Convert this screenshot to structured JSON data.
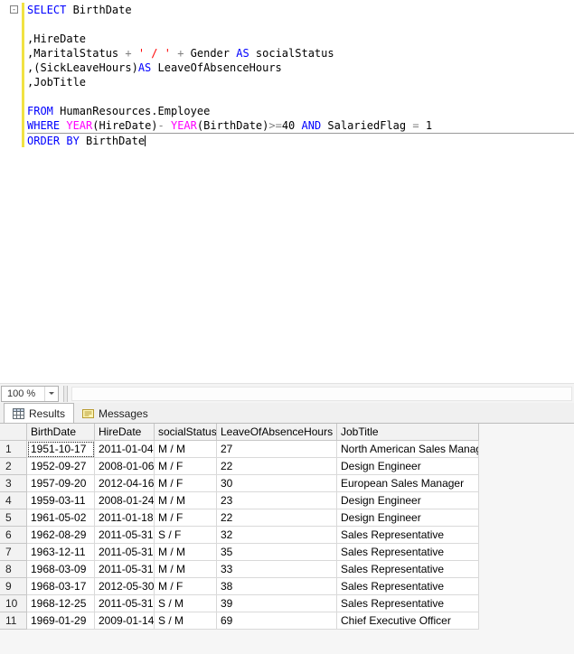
{
  "colors": {
    "keyword": "#0000ff",
    "function": "#ff00ff",
    "string": "#ff0000",
    "operator": "#808080",
    "plain": "#000000",
    "changed_bar": "#f1e243"
  },
  "editor": {
    "zoom_label": "100 %",
    "lines": [
      {
        "collapse": true,
        "changed": true,
        "tokens": [
          [
            "kw",
            "SELECT"
          ],
          [
            "pl",
            " BirthDate"
          ]
        ]
      },
      {
        "changed": true,
        "tokens": []
      },
      {
        "changed": true,
        "tokens": [
          [
            "pl",
            ",HireDate"
          ]
        ]
      },
      {
        "changed": true,
        "tokens": [
          [
            "pl",
            ",MaritalStatus "
          ],
          [
            "op",
            "+"
          ],
          [
            "pl",
            " "
          ],
          [
            "str",
            "' / '"
          ],
          [
            "pl",
            " "
          ],
          [
            "op",
            "+"
          ],
          [
            "pl",
            " Gender "
          ],
          [
            "kw",
            "AS"
          ],
          [
            "pl",
            " socialStatus"
          ]
        ]
      },
      {
        "changed": true,
        "tokens": [
          [
            "pl",
            ",(SickLeaveHours)"
          ],
          [
            "kw",
            "AS"
          ],
          [
            "pl",
            " LeaveOfAbsenceHours"
          ]
        ]
      },
      {
        "changed": true,
        "tokens": [
          [
            "pl",
            ",JobTitle"
          ]
        ]
      },
      {
        "changed": true,
        "tokens": []
      },
      {
        "changed": true,
        "tokens": [
          [
            "kw",
            "FROM"
          ],
          [
            "pl",
            " HumanResources.Employee"
          ]
        ]
      },
      {
        "changed": true,
        "tokens": [
          [
            "kw",
            "WHERE"
          ],
          [
            "pl",
            " "
          ],
          [
            "fn",
            "YEAR"
          ],
          [
            "pl",
            "(HireDate)"
          ],
          [
            "op",
            "-"
          ],
          [
            "pl",
            " "
          ],
          [
            "fn",
            "YEAR"
          ],
          [
            "pl",
            "(BirthDate)"
          ],
          [
            "op",
            ">="
          ],
          [
            "pl",
            "40 "
          ],
          [
            "kw",
            "AND"
          ],
          [
            "pl",
            " SalariedFlag "
          ],
          [
            "op",
            "="
          ],
          [
            "pl",
            " 1"
          ]
        ]
      },
      {
        "changed": true,
        "rule_above": true,
        "caret": true,
        "tokens": [
          [
            "kw",
            "ORDER BY"
          ],
          [
            "pl",
            " BirthDate"
          ]
        ]
      }
    ]
  },
  "results_pane": {
    "tabs": [
      {
        "label": "Results",
        "icon": "grid-icon",
        "active": true
      },
      {
        "label": "Messages",
        "icon": "message-icon",
        "active": false
      }
    ],
    "grid": {
      "columns": [
        "BirthDate",
        "HireDate",
        "socialStatus",
        "LeaveOfAbsenceHours",
        "JobTitle"
      ],
      "rows": [
        [
          "1951-10-17",
          "2011-01-04",
          "M / M",
          "27",
          "North American Sales Manager"
        ],
        [
          "1952-09-27",
          "2008-01-06",
          "M / F",
          "22",
          "Design Engineer"
        ],
        [
          "1957-09-20",
          "2012-04-16",
          "M / F",
          "30",
          "European Sales Manager"
        ],
        [
          "1959-03-11",
          "2008-01-24",
          "M / M",
          "23",
          "Design Engineer"
        ],
        [
          "1961-05-02",
          "2011-01-18",
          "M / F",
          "22",
          "Design Engineer"
        ],
        [
          "1962-08-29",
          "2011-05-31",
          "S / F",
          "32",
          "Sales Representative"
        ],
        [
          "1963-12-11",
          "2011-05-31",
          "M / M",
          "35",
          "Sales Representative"
        ],
        [
          "1968-03-09",
          "2011-05-31",
          "M / M",
          "33",
          "Sales Representative"
        ],
        [
          "1968-03-17",
          "2012-05-30",
          "M / F",
          "38",
          "Sales Representative"
        ],
        [
          "1968-12-25",
          "2011-05-31",
          "S / M",
          "39",
          "Sales Representative"
        ],
        [
          "1969-01-29",
          "2009-01-14",
          "S / M",
          "69",
          "Chief Executive Officer"
        ]
      ],
      "selected_cell": {
        "row": 0,
        "col": 0
      }
    }
  }
}
